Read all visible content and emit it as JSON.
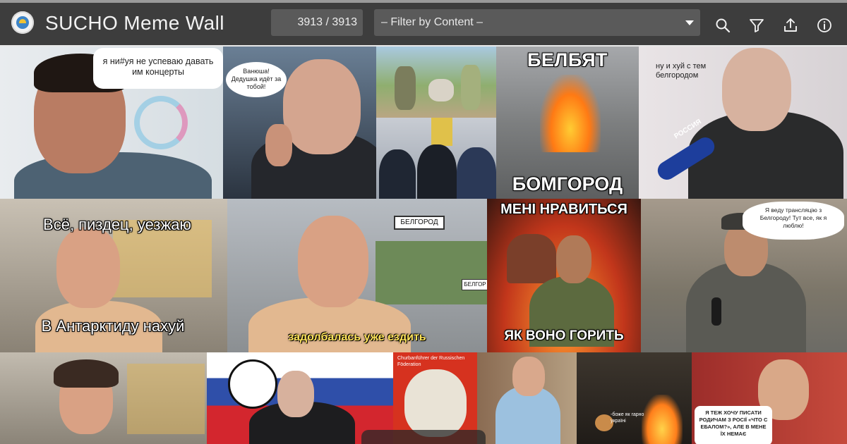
{
  "header": {
    "title": "SUCHO Meme Wall",
    "counter": "3913 / 3913",
    "filter_value": "– Filter by Content –"
  },
  "toolbar": {
    "icons": [
      "search-icon",
      "filter-icon",
      "share-icon",
      "info-icon"
    ]
  },
  "colors": {
    "topbar": "#3d3d3d",
    "input_bg": "#5a5a5a",
    "text": "#f2f2f2"
  },
  "memes": {
    "m1": "я ни#уя не успеваю давать им концерты",
    "m2": "Ванюша! Дедушка идёт за тобой!",
    "m5_top": "БЕЛБЯТ",
    "m5_bottom": "БОМГОРОД",
    "m6": "ну и хуй с тем белгородом",
    "m6_mic": "РОССИЯ",
    "m7_top": "Всё, пиздец, уезжаю",
    "m7_bottom": "В Антарктиду нахуй",
    "m8": "задолбалась уже ездить",
    "m8_sign": "БЕЛГОРОД",
    "m8_sign2": "БЕЛГОР",
    "m9_top": "МЕНІ НРАВИТЬСЯ",
    "m9_bottom": "ЯК ВОНО ГОРИТЬ",
    "m10": "Я веду трансляцію з Белгороду! Тут все, як я люблю!",
    "m13": "Churbanführer der Russischen Föderation",
    "m15": "-боже як гарно україні",
    "m16": "Я ТЕЖ ХОЧУ ПИСАТИ РОДИЧАМ З РОСІЇ «ЧТО С ЕБАЛОМ?», АЛЕ В МЕНЕ ЇХ НЕМАЄ"
  }
}
